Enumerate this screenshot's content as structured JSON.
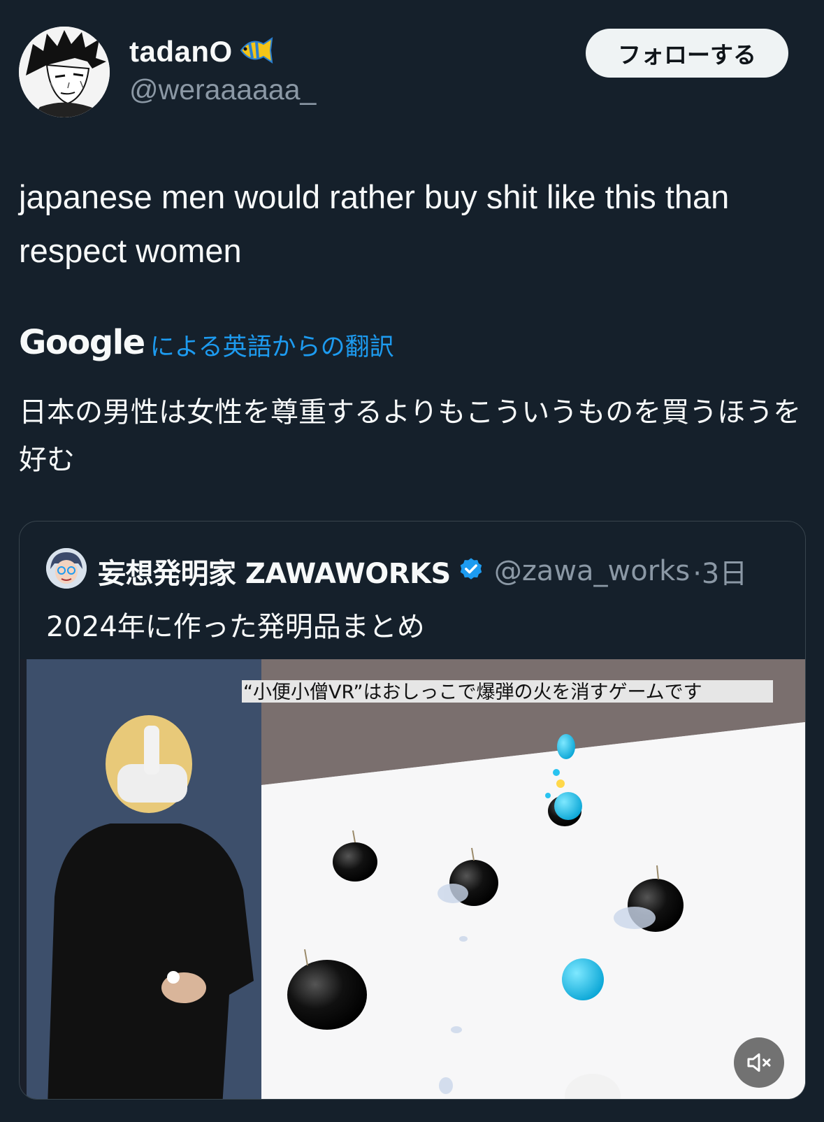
{
  "author": {
    "display_name": "tadanO",
    "handle": "@weraaaaaa_",
    "emoji_icon": "tropical-fish-icon"
  },
  "follow_button": {
    "label": "フォローする"
  },
  "tweet": {
    "text": "japanese men would rather buy shit like this than respect women"
  },
  "translation": {
    "provider": "Google",
    "label": "による英語からの翻訳",
    "text": "日本の男性は女性を尊重するよりもこういうものを買うほうを好む"
  },
  "quote": {
    "display_name": "妄想発明家 ZAWAWORKS",
    "verified": true,
    "handle": "@zawa_works",
    "time": "·3日",
    "text": "2024年に作った発明品まとめ",
    "media": {
      "caption": "“小便小僧VR”はおしっこで爆弾の火を消すゲームです",
      "muted": true
    }
  },
  "colors": {
    "background": "#15202b",
    "accent": "#1d9bf0",
    "secondary_text": "#8b98a5",
    "border": "#38444d"
  }
}
